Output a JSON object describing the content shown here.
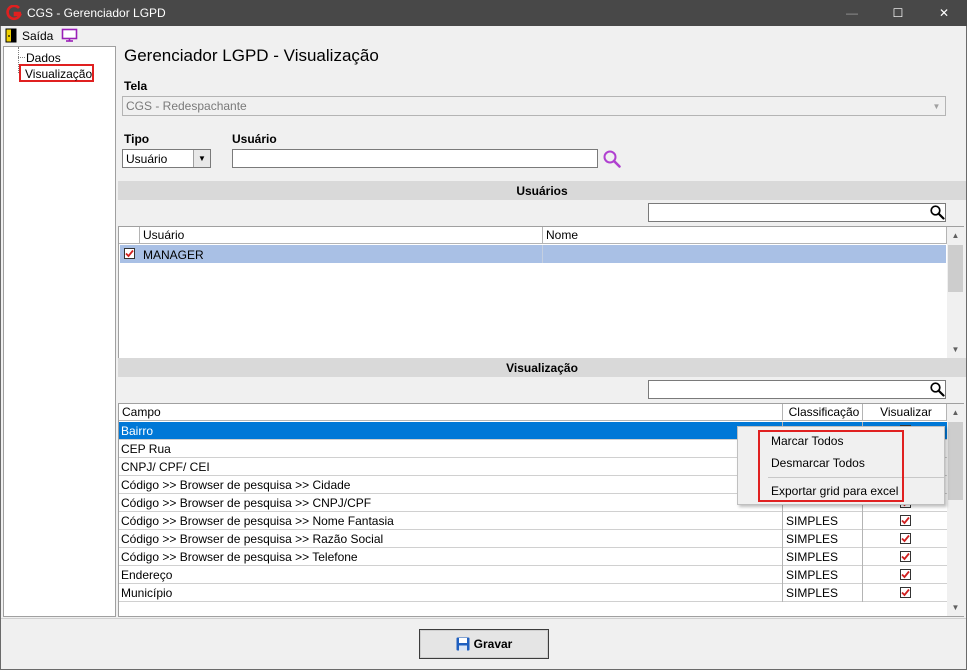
{
  "window": {
    "title": "CGS - Gerenciador LGPD",
    "min_glyph": "—",
    "max_glyph": "☐",
    "close_glyph": "✕"
  },
  "menubar": {
    "exit_label": "Saída"
  },
  "tree": {
    "items": [
      {
        "label": "Dados"
      },
      {
        "label": "Visualização"
      }
    ]
  },
  "page": {
    "title": "Gerenciador LGPD - Visualização",
    "tela_label": "Tela",
    "tela_value": "CGS - Redespachante",
    "tipo_label": "Tipo",
    "tipo_value": "Usuário",
    "usuario_label": "Usuário",
    "usuario_value": ""
  },
  "users": {
    "header": "Usuários",
    "search_value": "",
    "columns": [
      "Usuário",
      "Nome"
    ],
    "rows": [
      {
        "usuario": "MANAGER",
        "nome": "",
        "checked": true
      }
    ]
  },
  "visualizacao": {
    "header": "Visualização",
    "search_value": "",
    "columns": [
      "Campo",
      "Classificação",
      "Visualizar"
    ],
    "rows": [
      {
        "campo": "Bairro",
        "classificacao": "",
        "visualizar": true
      },
      {
        "campo": "CEP Rua",
        "classificacao": "",
        "visualizar": true
      },
      {
        "campo": "CNPJ/ CPF/ CEI",
        "classificacao": "",
        "visualizar": true
      },
      {
        "campo": "Código >> Browser de pesquisa >> Cidade",
        "classificacao": "",
        "visualizar": true
      },
      {
        "campo": "Código >> Browser de pesquisa >> CNPJ/CPF",
        "classificacao": "",
        "visualizar": true
      },
      {
        "campo": "Código >> Browser de pesquisa >> Nome Fantasia",
        "classificacao": "SIMPLES",
        "visualizar": true
      },
      {
        "campo": "Código >> Browser de pesquisa >> Razão Social",
        "classificacao": "SIMPLES",
        "visualizar": true
      },
      {
        "campo": "Código >> Browser de pesquisa >> Telefone",
        "classificacao": "SIMPLES",
        "visualizar": true
      },
      {
        "campo": "Endereço",
        "classificacao": "SIMPLES",
        "visualizar": true
      },
      {
        "campo": "Município",
        "classificacao": "SIMPLES",
        "visualizar": true
      }
    ]
  },
  "context_menu": {
    "items": [
      "Marcar Todos",
      "Desmarcar Todos",
      "Exportar grid para excel"
    ]
  },
  "footer": {
    "save_label": "Gravar"
  },
  "colors": {
    "titlebar": "#484848",
    "selected_row": "#0078d7",
    "highlight_border": "#e02020",
    "check_red": "#d02020"
  }
}
